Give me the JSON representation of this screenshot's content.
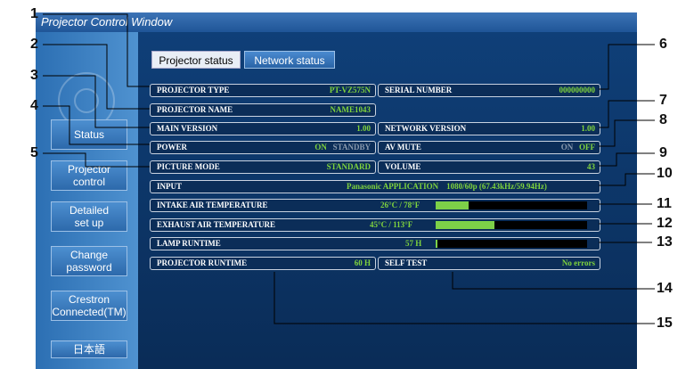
{
  "window": {
    "title": "Projector Control Window"
  },
  "sidebar": {
    "status": "Status",
    "projector_control": "Projector\ncontrol",
    "detailed_setup": "Detailed\nset up",
    "change_password": "Change\npassword",
    "crestron": "Crestron\nConnected(TM)",
    "language": "日本語"
  },
  "tabs": {
    "projector_status": "Projector status",
    "network_status": "Network status"
  },
  "status": {
    "projector_type": {
      "label": "PROJECTOR TYPE",
      "value": "PT-VZ575N"
    },
    "serial_number": {
      "label": "SERIAL NUMBER",
      "value": "000000000"
    },
    "projector_name": {
      "label": "PROJECTOR NAME",
      "value": "NAME1043"
    },
    "main_version": {
      "label": "MAIN VERSION",
      "value": "1.00"
    },
    "network_version": {
      "label": "NETWORK VERSION",
      "value": "1.00"
    },
    "power": {
      "label": "POWER",
      "on": "ON",
      "standby": "STANDBY"
    },
    "av_mute": {
      "label": "AV MUTE",
      "on": "ON",
      "off": "OFF"
    },
    "picture_mode": {
      "label": "PICTURE MODE",
      "value": "STANDARD"
    },
    "volume": {
      "label": "VOLUME",
      "value": "43"
    },
    "input": {
      "label": "INPUT",
      "value": "Panasonic APPLICATION",
      "signal": "1080/60p (67.43kHz/59.94Hz)"
    },
    "intake_air": {
      "label": "INTAKE AIR TEMPERATURE",
      "value": "26°C / 78°F",
      "level": 0.22
    },
    "exhaust_air": {
      "label": "EXHAUST AIR TEMPERATURE",
      "value": "45°C / 113°F",
      "level": 0.39
    },
    "lamp_runtime": {
      "label": "LAMP RUNTIME",
      "value": "57 H",
      "level": 0.01
    },
    "projector_runtime": {
      "label": "PROJECTOR RUNTIME",
      "value": "60 H"
    },
    "self_test": {
      "label": "SELF TEST",
      "value": "No errors"
    }
  },
  "callouts": [
    "1",
    "2",
    "3",
    "4",
    "5",
    "6",
    "7",
    "8",
    "9",
    "10",
    "11",
    "12",
    "13",
    "14",
    "15"
  ]
}
